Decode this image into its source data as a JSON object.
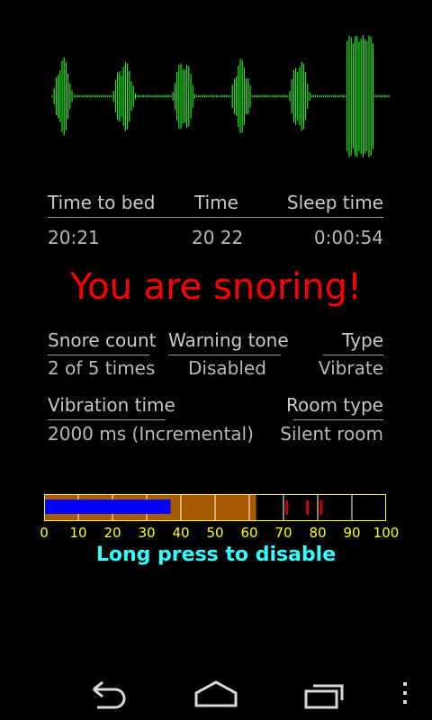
{
  "waveform": {
    "color": "#22e822",
    "icon": "waveform"
  },
  "stats_top": {
    "headers": [
      "Time to bed",
      "Time",
      "Sleep time"
    ],
    "values": [
      "20:21",
      "20 22",
      "0:00:54"
    ]
  },
  "alert": {
    "text": "You are snoring!",
    "color": "#ff0000"
  },
  "settings": {
    "snore_count": {
      "label": "Snore count",
      "value": "2 of 5 times"
    },
    "warning_tone": {
      "label": "Warning tone",
      "value": "Disabled"
    },
    "type": {
      "label": "Type",
      "value": "Vibrate"
    },
    "vibration_time": {
      "label": "Vibration time",
      "value": "2000 ms (Incremental)"
    },
    "room_type": {
      "label": "Room type",
      "value": "Silent room"
    }
  },
  "meter": {
    "level": 37,
    "threshold": 62,
    "peaks": [
      71,
      77,
      81
    ],
    "scale": [
      "0",
      "10",
      "20",
      "30",
      "40",
      "50",
      "60",
      "70",
      "80",
      "90",
      "100"
    ],
    "colors": {
      "level": "#0000ff",
      "threshold_zone": "#a85a00",
      "peak": "#cc0000",
      "border": "#ffff00",
      "grid": "#ffffff"
    }
  },
  "hint": {
    "text": "Long press to disable"
  },
  "navbar": {
    "icons": [
      "back-icon",
      "home-icon",
      "recent-apps-icon",
      "overflow-menu-icon"
    ]
  }
}
